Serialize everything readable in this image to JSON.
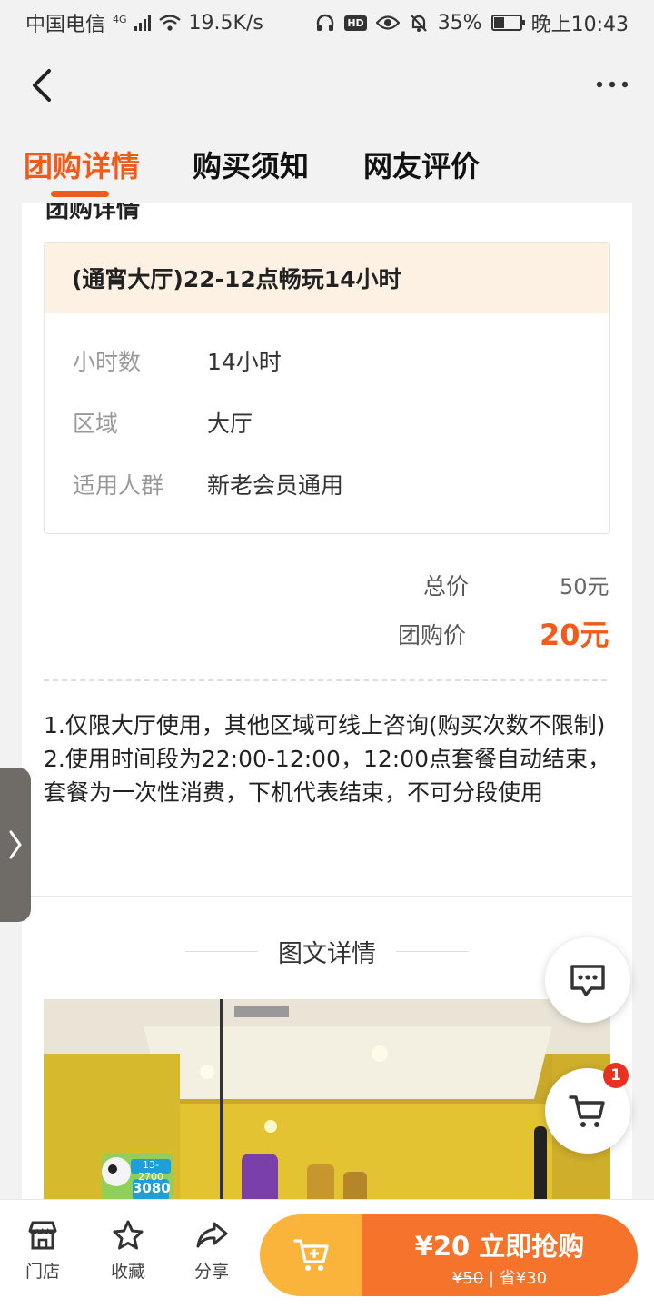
{
  "status_bar": {
    "carrier": "中国电信",
    "network": "4G",
    "speed": "19.5K/s",
    "hd": "HD",
    "battery": "35%",
    "time": "晚上10:43"
  },
  "tabs": [
    {
      "label": "团购详情"
    },
    {
      "label": "购买须知"
    },
    {
      "label": "网友评价"
    }
  ],
  "section_cut_title": "团购详情",
  "package": {
    "title": "(通宵大厅)22-12点畅玩14小时",
    "rows": [
      {
        "key": "小时数",
        "value": "14小时"
      },
      {
        "key": "区域",
        "value": "大厅"
      },
      {
        "key": "适用人群",
        "value": "新老会员通用"
      }
    ]
  },
  "price": {
    "total_label": "总价",
    "total_value": "50元",
    "group_label": "团购价",
    "group_value": "20元"
  },
  "notes": {
    "line1": "1.仅限大厅使用，其他区域可线上咨询(购买次数不限制)",
    "line2": "2.使用时间段为22:00-12:00，12:00点套餐自动结束，套餐为一次性消费，下机代表结束，不可分段使用"
  },
  "detail_section_title": "图文详情",
  "photo_signs": {
    "sign1": "13-2700",
    "sign2": "3080"
  },
  "cart_badge": "1",
  "bottom_bar": {
    "store": "门店",
    "favorite": "收藏",
    "share": "分享",
    "buy_price": "¥20 立即抢购",
    "original_price": "¥50",
    "save_text": "省¥30"
  },
  "colors": {
    "accent": "#f05a1a",
    "buy_orange": "#f5732a",
    "buy_yellow": "#fbb43b",
    "package_header_bg": "#fdf1e3"
  }
}
